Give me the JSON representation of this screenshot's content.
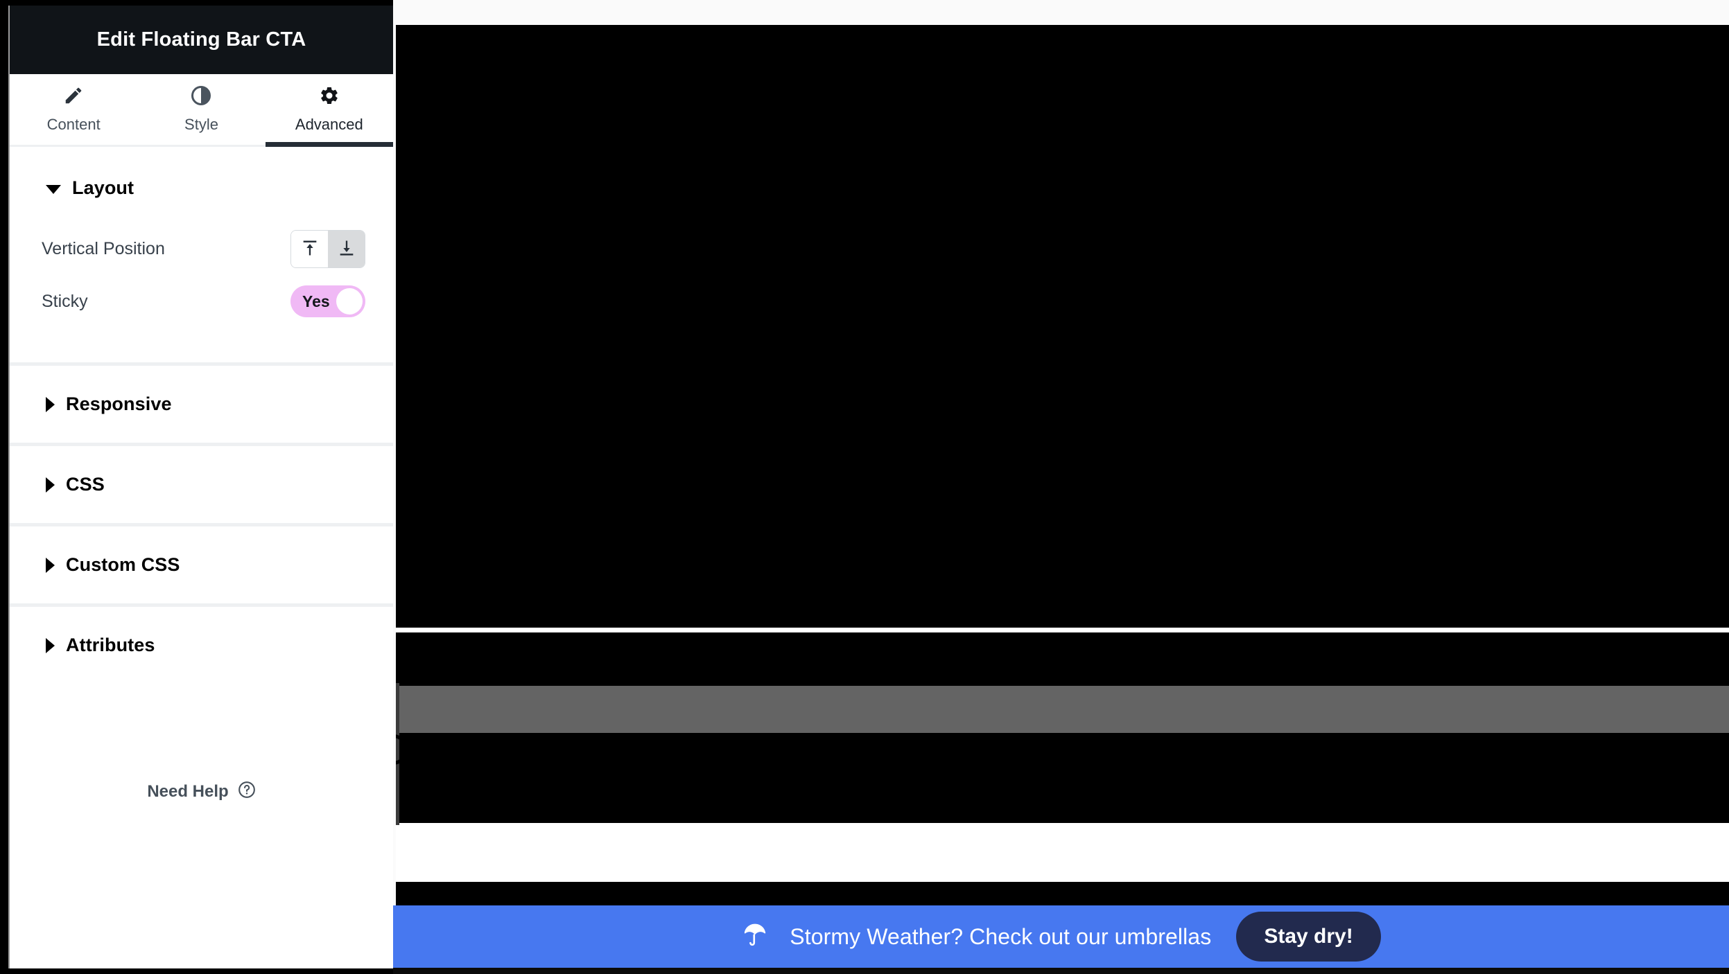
{
  "panel": {
    "title": "Edit Floating Bar CTA",
    "tabs": [
      {
        "label": "Content",
        "icon": "pencil-icon",
        "active": false
      },
      {
        "label": "Style",
        "icon": "contrast-icon",
        "active": false
      },
      {
        "label": "Advanced",
        "icon": "gear-icon",
        "active": true
      }
    ],
    "sections": [
      {
        "key": "layout",
        "label": "Layout",
        "expanded": true
      },
      {
        "key": "responsive",
        "label": "Responsive",
        "expanded": false
      },
      {
        "key": "css",
        "label": "CSS",
        "expanded": false
      },
      {
        "key": "custom_css",
        "label": "Custom CSS",
        "expanded": false
      },
      {
        "key": "attributes",
        "label": "Attributes",
        "expanded": false
      }
    ],
    "layout_fields": {
      "vertical_position": {
        "label": "Vertical Position",
        "options": [
          {
            "value": "top",
            "icon": "align-top-icon",
            "selected": false
          },
          {
            "value": "bottom",
            "icon": "align-bottom-icon",
            "selected": true
          }
        ]
      },
      "sticky": {
        "label": "Sticky",
        "value": "Yes",
        "on": true
      }
    },
    "need_help": {
      "label": "Need Help",
      "icon": "question-circle-icon"
    }
  },
  "preview": {
    "cta": {
      "icon": "umbrella-icon",
      "message": "Stormy Weather? Check out our umbrellas",
      "button_label": "Stay dry!"
    }
  },
  "colors": {
    "header_bg": "#101418",
    "accent_toggle": "#f0b9f5",
    "cta_bar_bg": "#4778f0",
    "cta_button_bg": "#222a4e",
    "active_tab_indicator": "#252d36",
    "preview_gray_band": "#646464"
  }
}
